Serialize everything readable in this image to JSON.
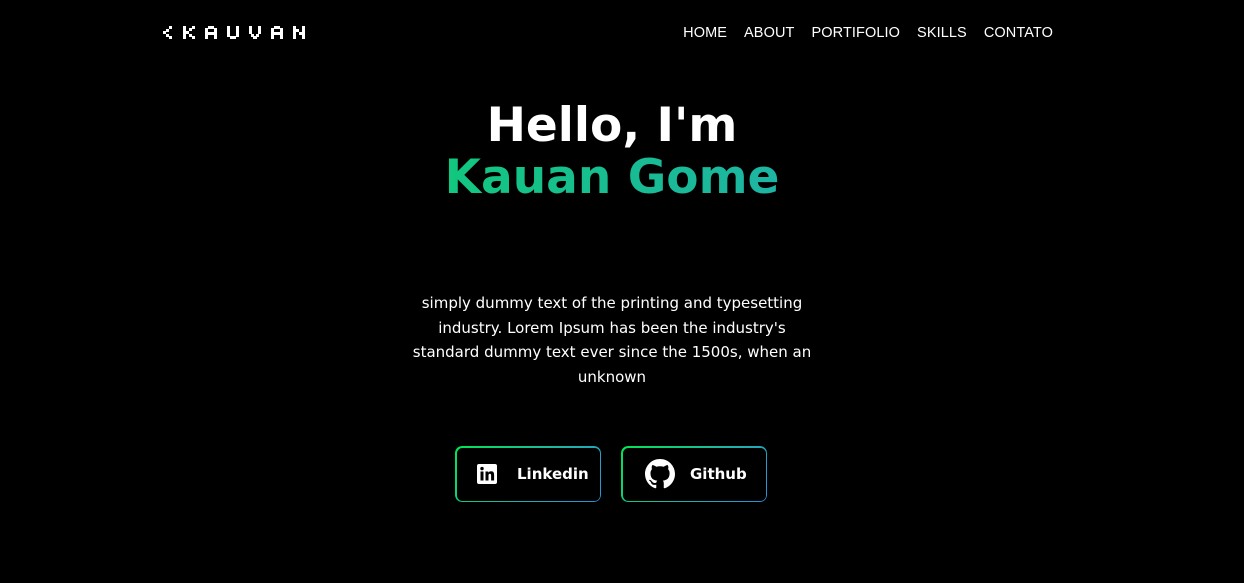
{
  "brand": {
    "logo_text": "<KAUAN/>",
    "icon": "pixel-logo"
  },
  "nav": {
    "items": [
      {
        "label": "HOME"
      },
      {
        "label": "ABOUT"
      },
      {
        "label": "PORTIFOLIO"
      },
      {
        "label": "SKILLS"
      },
      {
        "label": "CONTATO"
      }
    ]
  },
  "hero": {
    "greeting": "Hello, I'm",
    "name": "Kauan Gome",
    "description": "simply dummy text of the printing and typesetting industry. Lorem Ipsum has been the industry's standard dummy text ever since the 1500s, when an unknown"
  },
  "buttons": [
    {
      "label": "Linkedin",
      "icon": "linkedin-icon"
    },
    {
      "label": "Github",
      "icon": "github-icon"
    }
  ],
  "colors": {
    "background": "#000000",
    "text": "#ffffff",
    "gradient_start": "#00e651",
    "gradient_end": "#2a9fd6"
  }
}
